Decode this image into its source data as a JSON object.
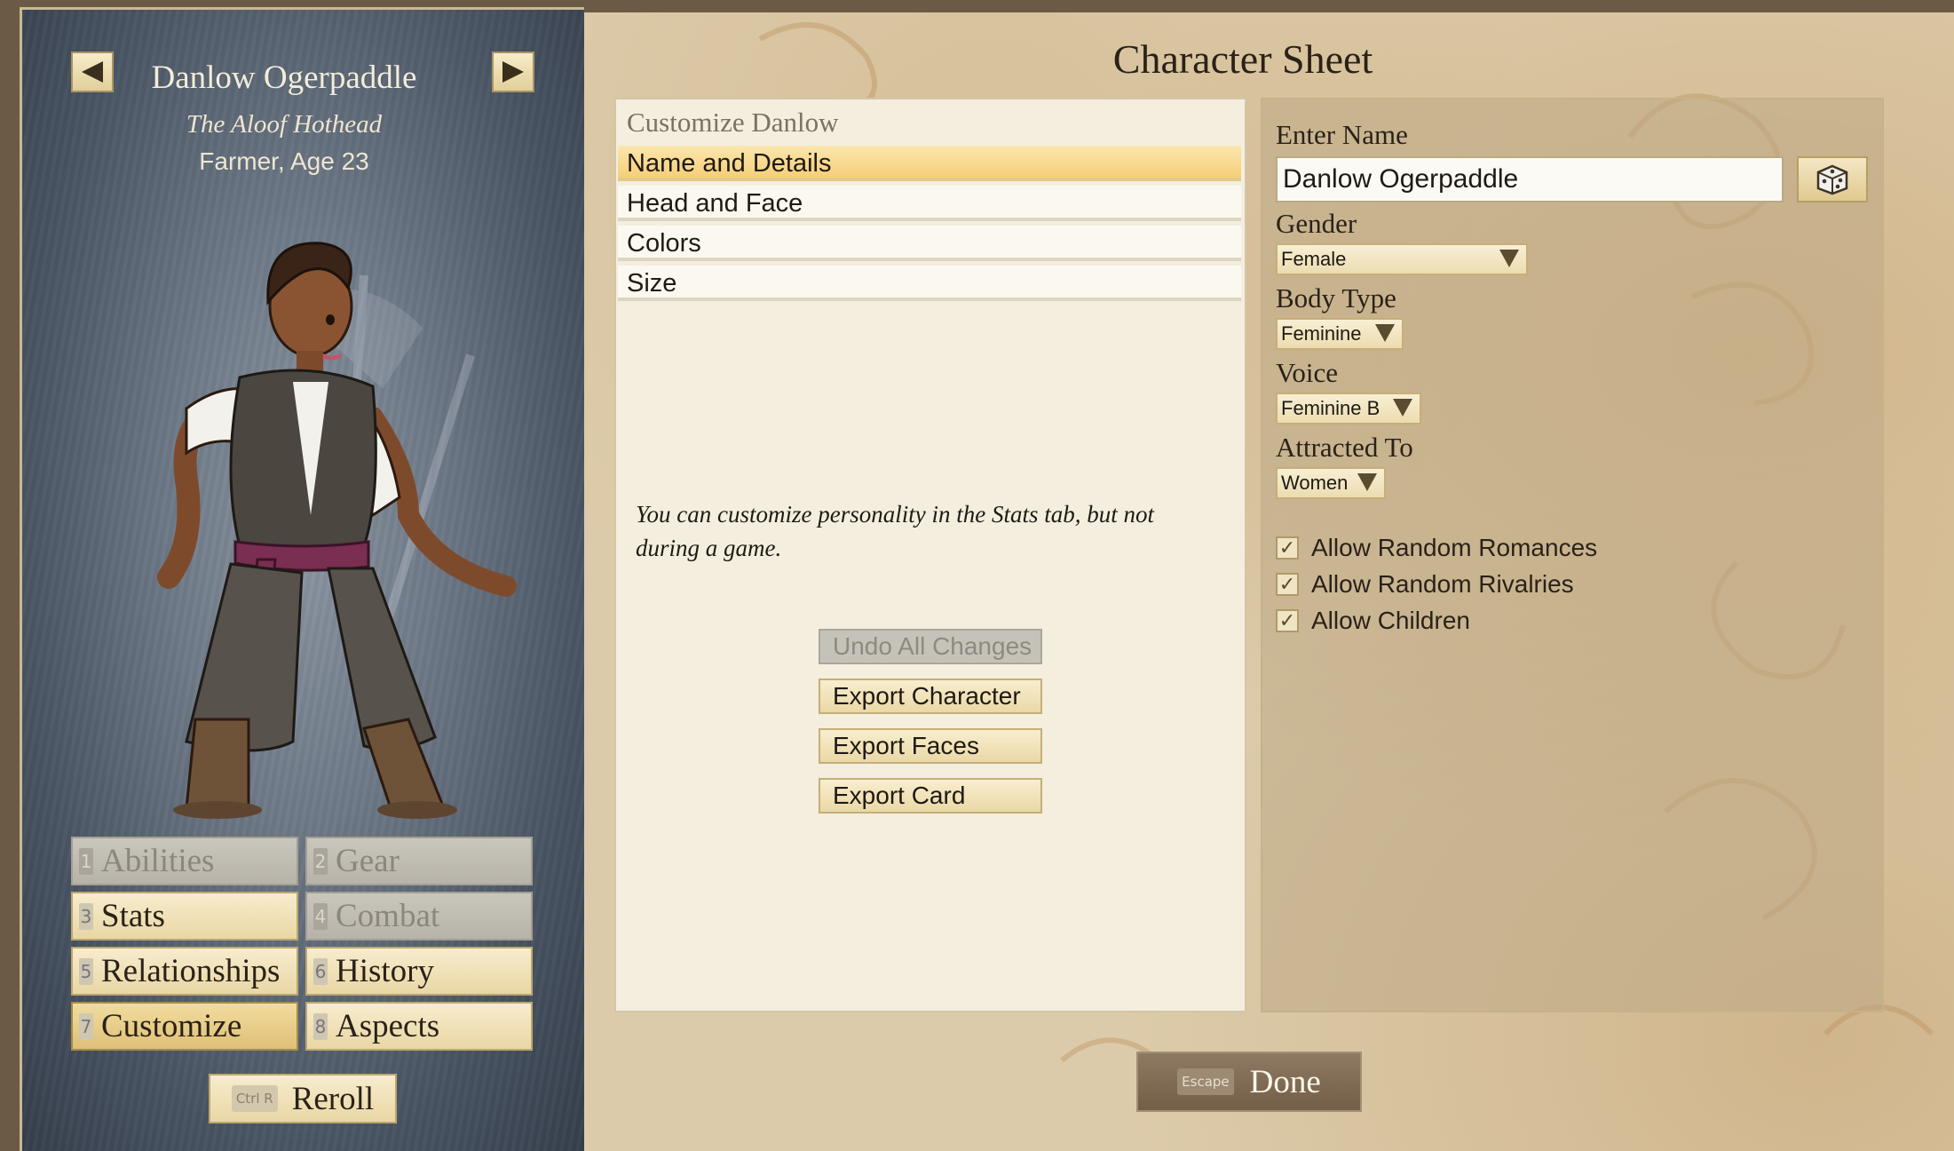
{
  "character": {
    "name": "Danlow Ogerpaddle",
    "title": "The Aloof Hothead",
    "subtitle": "Farmer, Age 23"
  },
  "icons": {
    "prev": "arrow-left-icon",
    "next": "arrow-right-icon",
    "dice": "dice-icon",
    "checkmark": "checkmark-icon"
  },
  "tabs": [
    {
      "key": "1",
      "label": "Abilities",
      "state": "disabled"
    },
    {
      "key": "2",
      "label": "Gear",
      "state": "disabled"
    },
    {
      "key": "3",
      "label": "Stats",
      "state": "enabled"
    },
    {
      "key": "4",
      "label": "Combat",
      "state": "disabled"
    },
    {
      "key": "5",
      "label": "Relationships",
      "state": "enabled"
    },
    {
      "key": "6",
      "label": "History",
      "state": "enabled"
    },
    {
      "key": "7",
      "label": "Customize",
      "state": "active"
    },
    {
      "key": "8",
      "label": "Aspects",
      "state": "enabled"
    }
  ],
  "reroll": {
    "key": "Ctrl R",
    "label": "Reroll"
  },
  "sheet_title": "Character Sheet",
  "customize": {
    "header": "Customize Danlow",
    "items": [
      "Name and Details",
      "Head and Face",
      "Colors",
      "Size"
    ],
    "selected": "Name and Details",
    "note": "You can customize personality in the Stats tab, but not during a game.",
    "actions": [
      {
        "label": "Undo All Changes",
        "state": "disabled"
      },
      {
        "label": "Export Character",
        "state": "enabled"
      },
      {
        "label": "Export Faces",
        "state": "enabled"
      },
      {
        "label": "Export Card",
        "state": "enabled"
      }
    ]
  },
  "details": {
    "name_label": "Enter Name",
    "name_value": "Danlow Ogerpaddle",
    "gender_label": "Gender",
    "gender_value": "Female",
    "body_label": "Body Type",
    "body_value": "Feminine",
    "voice_label": "Voice",
    "voice_value": "Feminine B",
    "attracted_label": "Attracted To",
    "attracted_value": "Women",
    "checkboxes": [
      {
        "label": "Allow Random Romances",
        "checked": true
      },
      {
        "label": "Allow Random Rivalries",
        "checked": true
      },
      {
        "label": "Allow Children",
        "checked": true
      }
    ]
  },
  "done": {
    "key": "Escape",
    "label": "Done"
  },
  "colors": {
    "accent": "#f5cf78",
    "parchment": "#dccbaa",
    "panel": "#4a5564"
  }
}
